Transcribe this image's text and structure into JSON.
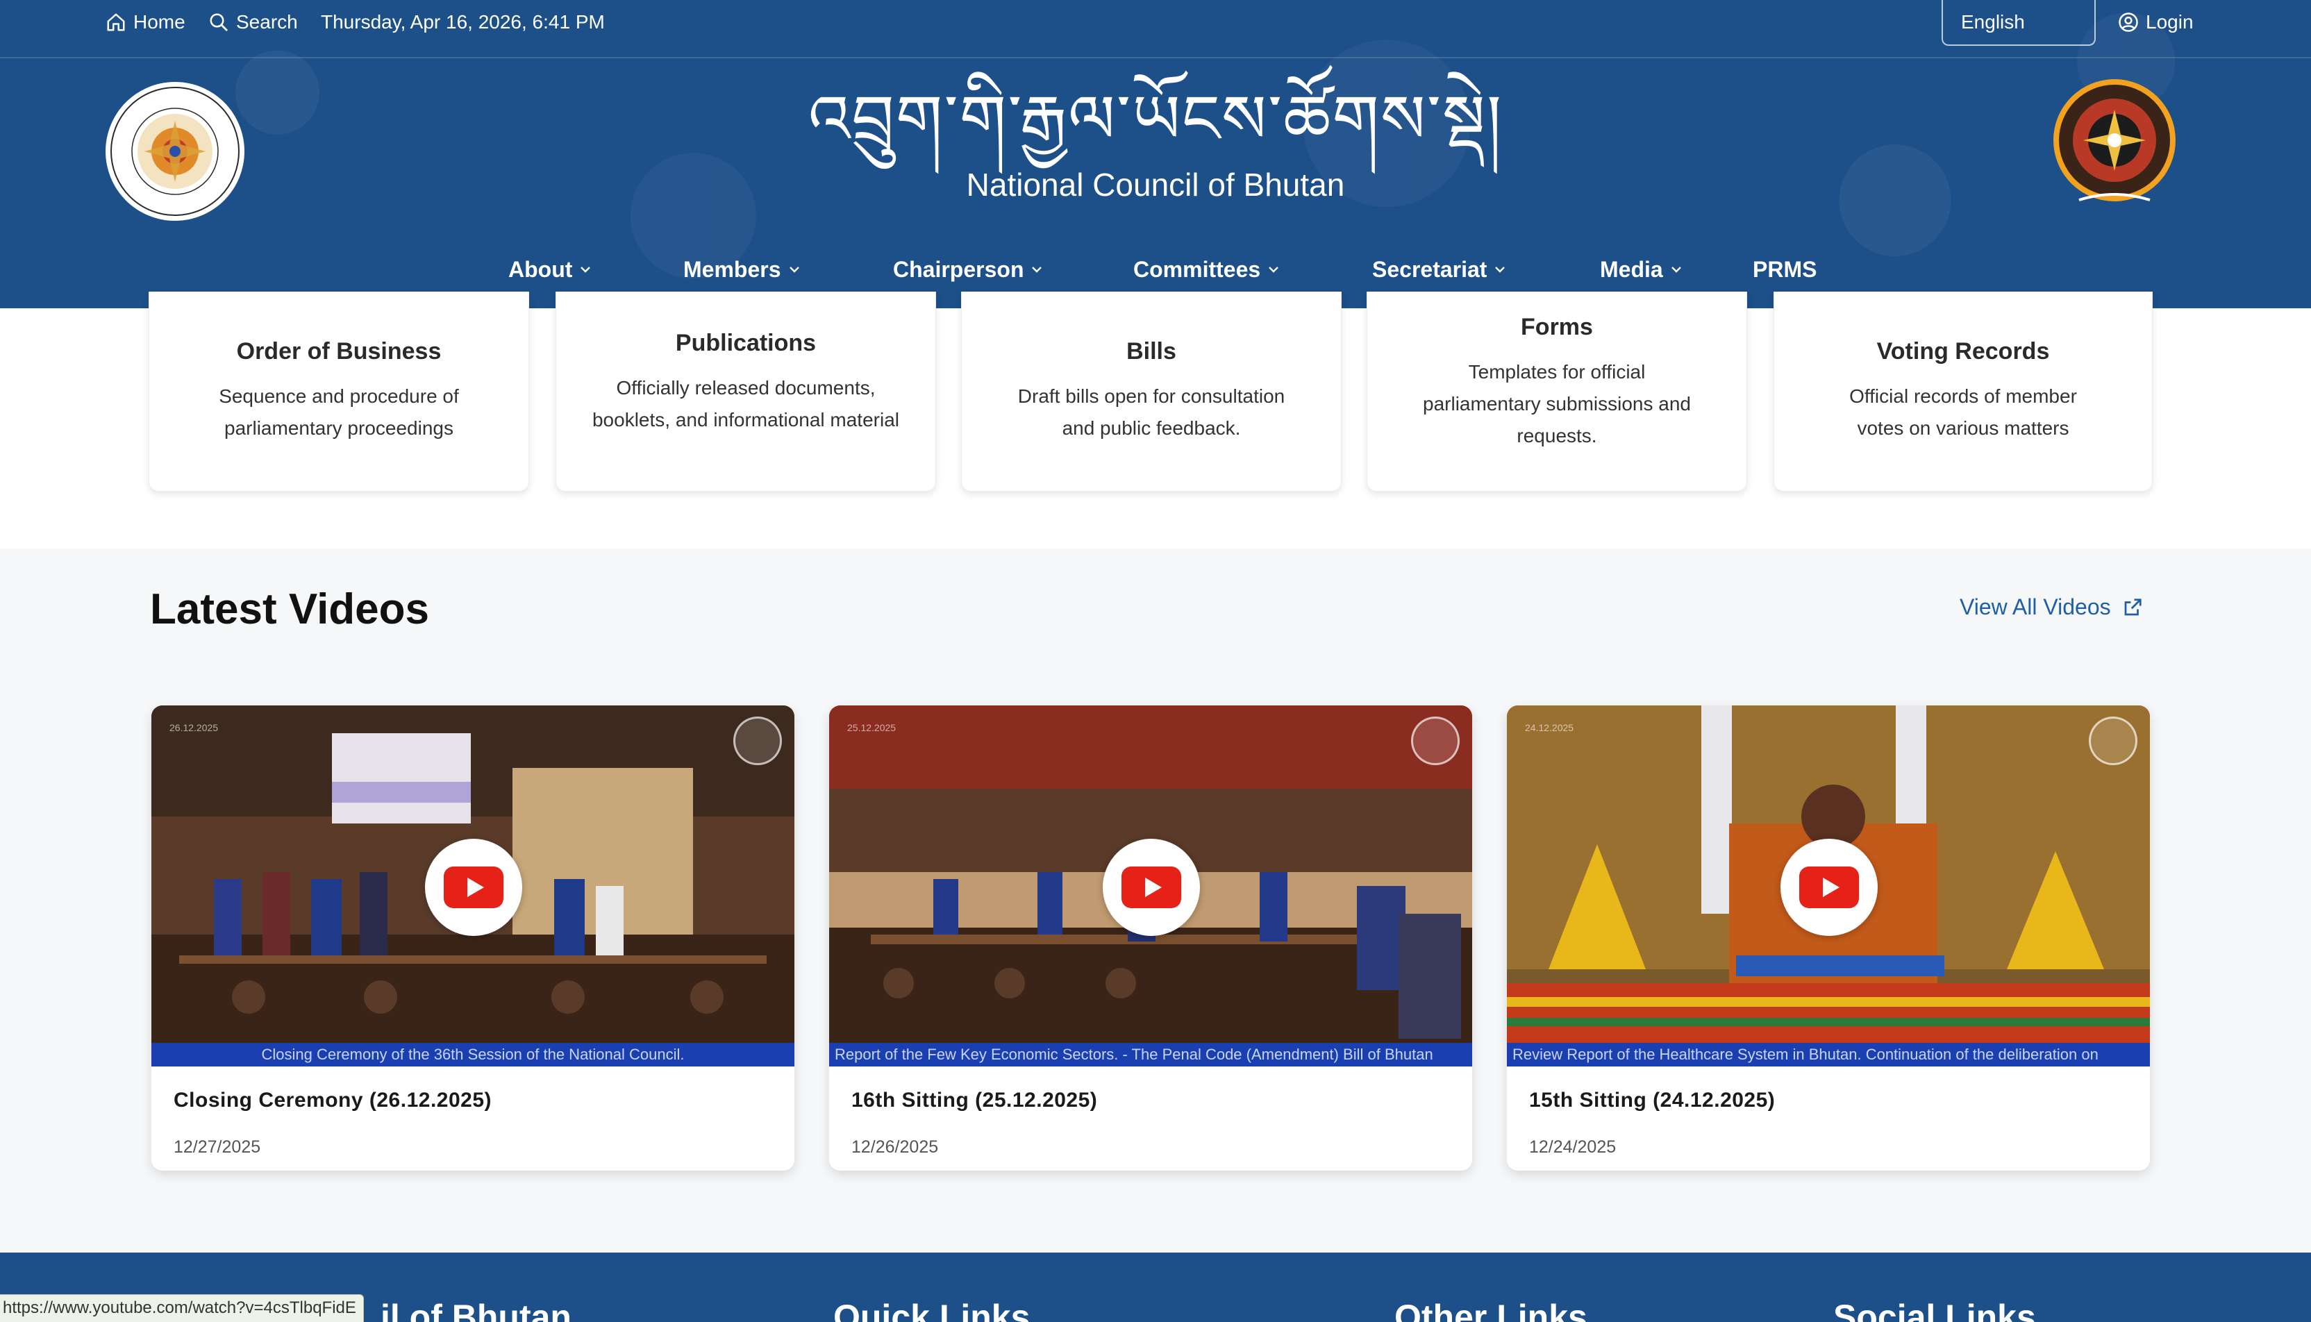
{
  "topbar": {
    "home_label": "Home",
    "search_label": "Search",
    "datetime": "Thursday, Apr 16, 2026, 6:41 PM",
    "language": "English",
    "login_label": "Login"
  },
  "header": {
    "title_dzongkha": "འབྲུག་གི་རྒྱལ་ཡོངས་ཚོགས་སྡེ།",
    "title_english": "National Council of Bhutan"
  },
  "nav": {
    "items": [
      {
        "label": "About",
        "has_dropdown": true
      },
      {
        "label": "Members",
        "has_dropdown": true
      },
      {
        "label": "Chairperson",
        "has_dropdown": true
      },
      {
        "label": "Committees",
        "has_dropdown": true
      },
      {
        "label": "Secretariat",
        "has_dropdown": true
      },
      {
        "label": "Media",
        "has_dropdown": true
      },
      {
        "label": "PRMS",
        "has_dropdown": false
      }
    ]
  },
  "resource_cards": [
    {
      "title": "Order of Business",
      "description": "Sequence and procedure of parliamentary proceedings"
    },
    {
      "title": "Publications",
      "description": "Officially released documents, booklets, and informational material"
    },
    {
      "title": "Bills",
      "description": "Draft bills open for consultation and public feedback."
    },
    {
      "title": "Forms",
      "description": "Templates for official parliamentary submissions and requests."
    },
    {
      "title": "Voting Records",
      "description": "Official records of member votes on various matters"
    }
  ],
  "videos": {
    "section_title": "Latest Videos",
    "view_all_label": "View All Videos",
    "items": [
      {
        "title": "Closing Ceremony (26.12.2025)",
        "date": "12/27/2025",
        "ticker": "Closing Ceremony of the 36th Session of the National Council.",
        "stamp": "26.12.2025"
      },
      {
        "title": "16th Sitting (25.12.2025)",
        "date": "12/26/2025",
        "ticker": "Report of the Few Key Economic Sectors. - The Penal Code (Amendment) Bill of Bhutan",
        "stamp": "25.12.2025"
      },
      {
        "title": "15th Sitting (24.12.2025)",
        "date": "12/24/2025",
        "ticker": "Review Report of the Healthcare System in Bhutan.  Continuation of the deliberation on",
        "stamp": "24.12.2025"
      }
    ]
  },
  "footer": {
    "headings": [
      "il of Bhutan",
      "Quick Links",
      "Other Links",
      "Social Links"
    ]
  },
  "status_bar": {
    "url": "https://www.youtube.com/watch?v=4csTlbqFidE"
  },
  "colors": {
    "header_bg": "#1d4f88",
    "link_blue": "#1f5fa8",
    "youtube_red": "#e62117",
    "ticker_blue": "#1a3fb0"
  }
}
